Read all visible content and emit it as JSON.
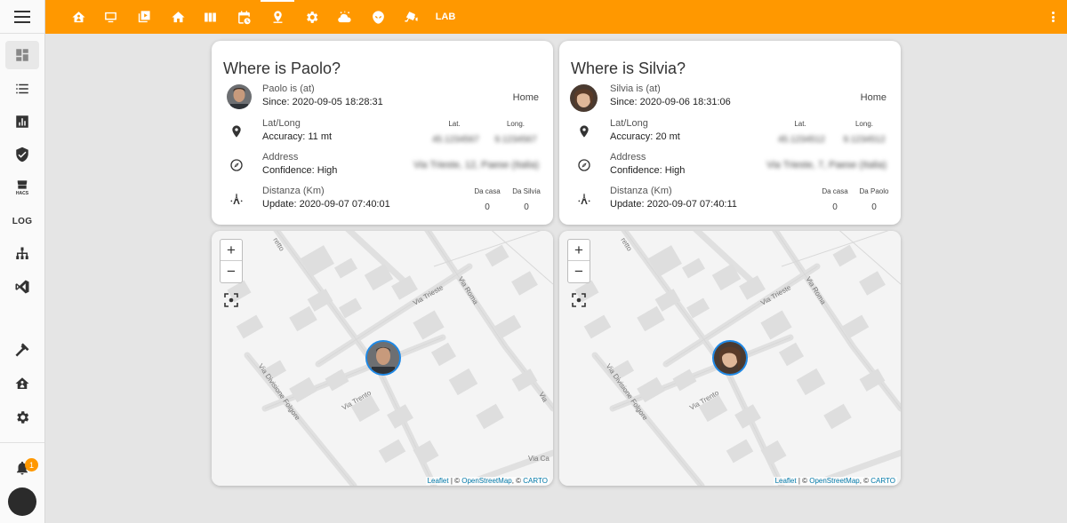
{
  "topbar": {
    "lab_label": "LAB"
  },
  "sidebar": {
    "log_label": "LOG",
    "hacs_label": "HACS",
    "notification_count": "1"
  },
  "cards": [
    {
      "title": "Where is Paolo?",
      "status_label": "Paolo is (at)",
      "since": "Since: 2020-09-05 18:28:31",
      "location": "Home",
      "latlong_label": "Lat/Long",
      "accuracy": "Accuracy: 11 mt",
      "lat_header": "Lat.",
      "long_header": "Long.",
      "lat_value": "45.1234567",
      "long_value": "9.1234567",
      "address_label": "Address",
      "confidence": "Confidence: High",
      "address_value": "Via Trieste, 12, Paese (Italia)",
      "distance_label": "Distanza (Km)",
      "update": "Update: 2020-09-07 07:40:01",
      "col1_header": "Da casa",
      "col2_header": "Da Silvia",
      "col1_value": "0",
      "col2_value": "0"
    },
    {
      "title": "Where is Silvia?",
      "status_label": "Silvia is (at)",
      "since": "Since: 2020-09-06 18:31:06",
      "location": "Home",
      "latlong_label": "Lat/Long",
      "accuracy": "Accuracy: 20 mt",
      "lat_header": "Lat.",
      "long_header": "Long.",
      "lat_value": "45.1234512",
      "long_value": "9.1234512",
      "address_label": "Address",
      "confidence": "Confidence: High",
      "address_value": "Via Trieste, 7, Paese (Italia)",
      "distance_label": "Distanza (Km)",
      "update": "Update: 2020-09-07 07:40:11",
      "col1_header": "Da casa",
      "col2_header": "Da Paolo",
      "col1_value": "0",
      "col2_value": "0"
    }
  ],
  "map": {
    "zoom_in": "+",
    "zoom_out": "−",
    "streets": [
      "Via Trieste",
      "Via Roma",
      "Via Trento",
      "Via Divisione Folgore",
      "Via Ca",
      "Via",
      "retto"
    ],
    "attribution": {
      "leaflet": "Leaflet",
      "sep1": " | © ",
      "osm": "OpenStreetMap",
      "sep2": ", © ",
      "carto": "CARTO"
    }
  },
  "colors": {
    "accent": "#ff9800",
    "marker_border": "#1e88e5"
  }
}
